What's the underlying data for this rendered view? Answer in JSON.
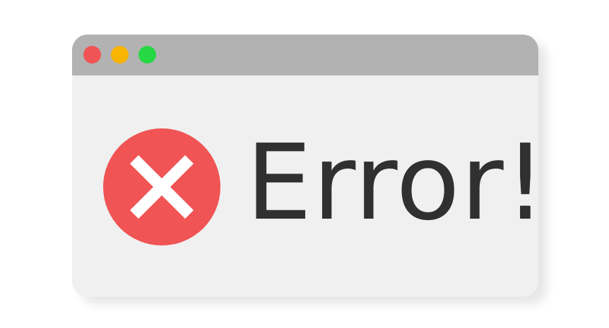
{
  "window": {
    "controls": [
      {
        "name": "close",
        "color": "#f05454"
      },
      {
        "name": "minimize",
        "color": "#f7b500"
      },
      {
        "name": "maximize",
        "color": "#27d845"
      }
    ],
    "titlebar_color": "#b2b2b2",
    "background_color": "#f0f0f0"
  },
  "error": {
    "icon": "x-circle-icon",
    "icon_color": "#f05454",
    "message": "Error!",
    "text_color": "#303030"
  }
}
